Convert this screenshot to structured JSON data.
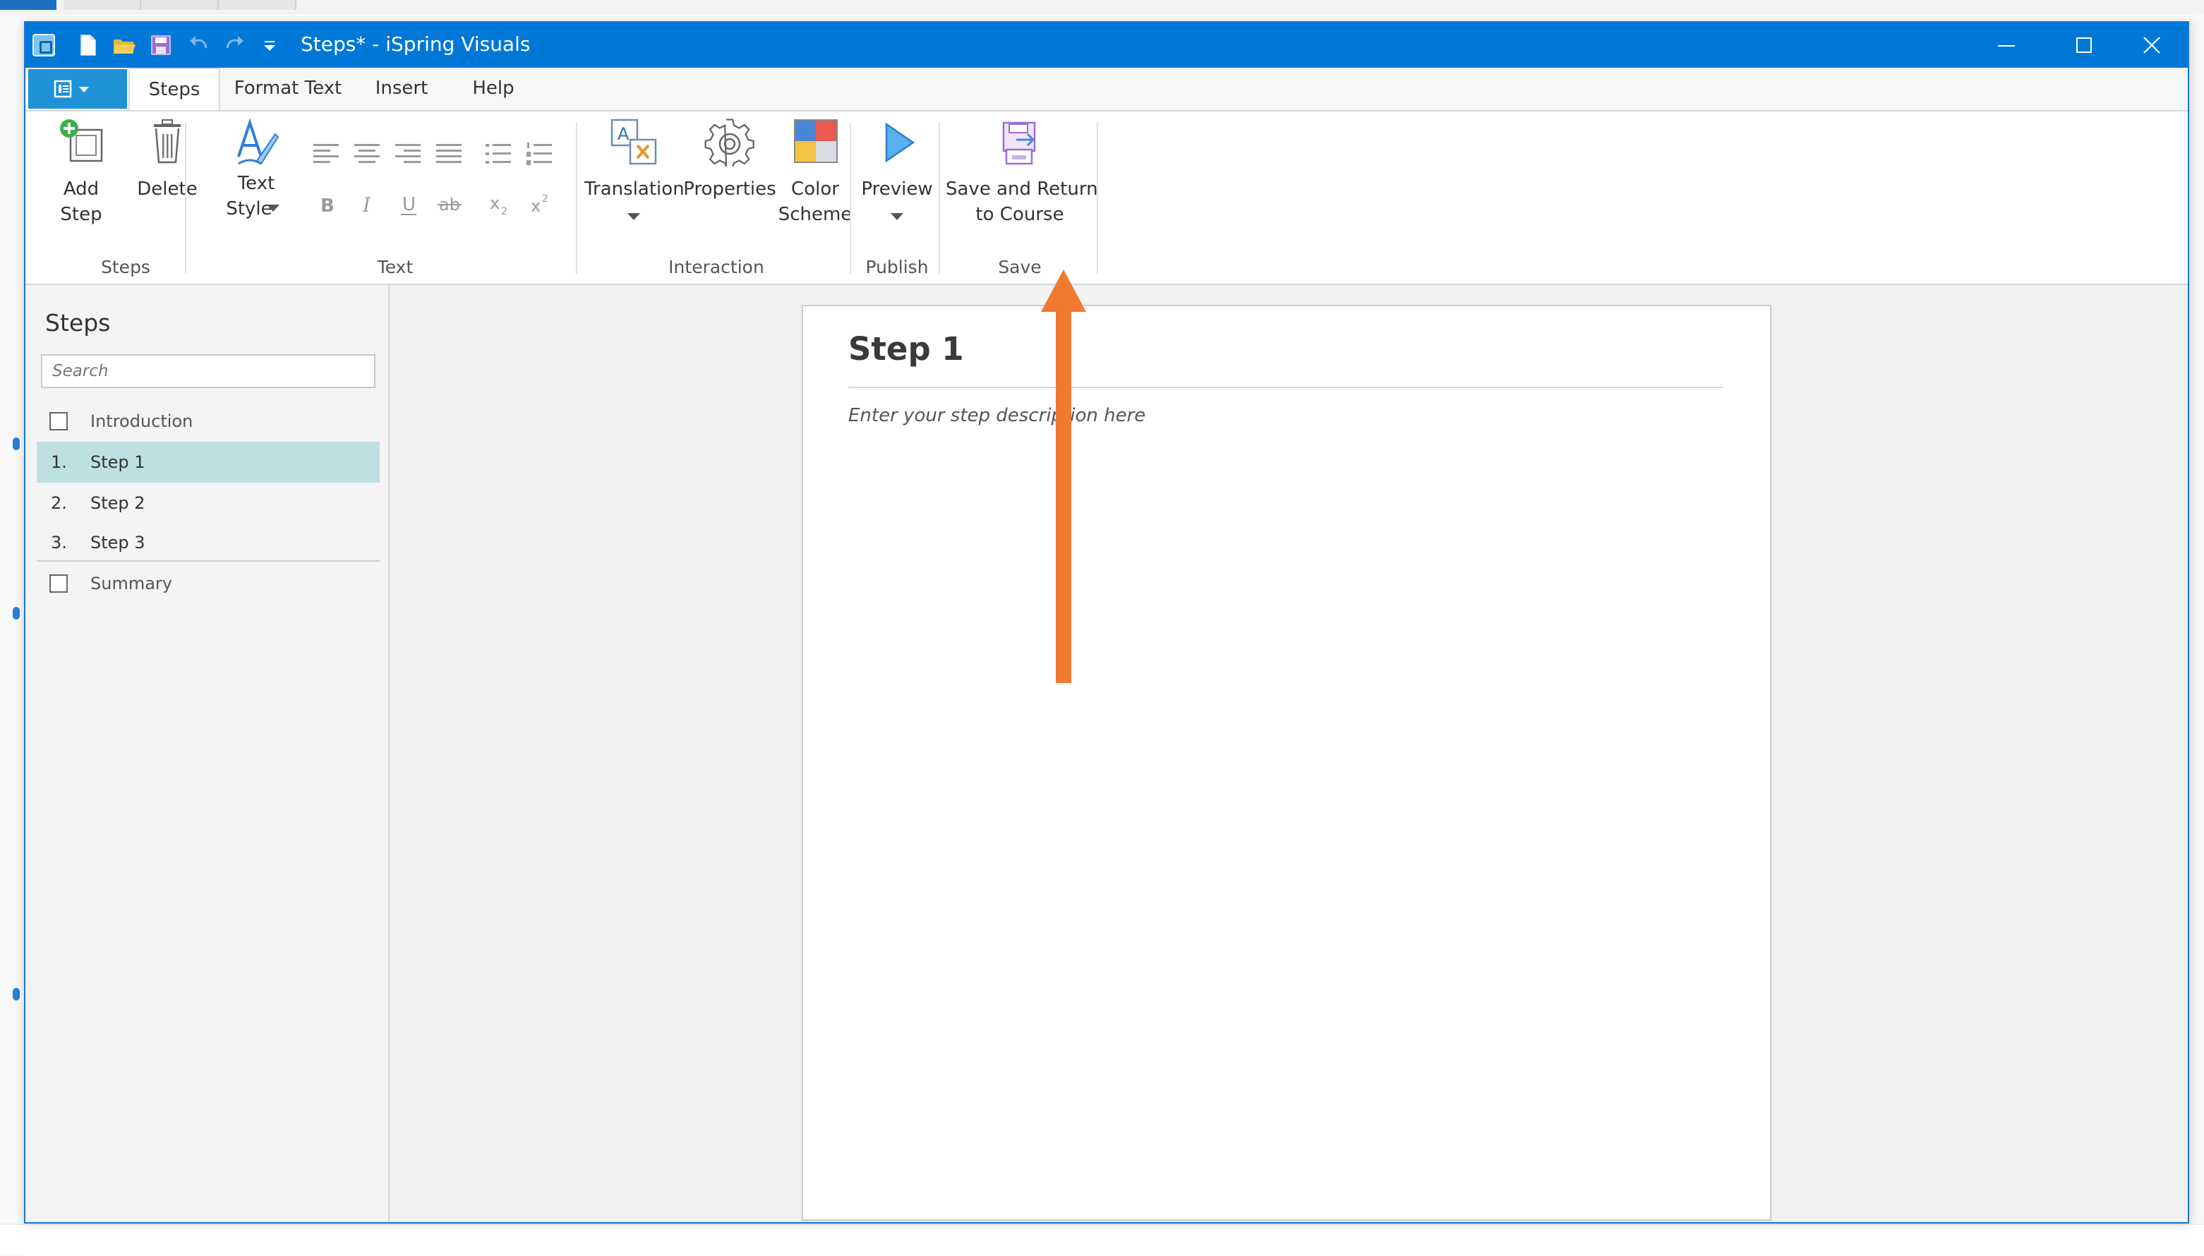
{
  "window": {
    "title": "Steps* - iSpring Visuals"
  },
  "tabs": [
    "Steps",
    "Format Text",
    "Insert",
    "Help"
  ],
  "ribbon": {
    "steps_group": {
      "label": "Steps",
      "add_line1": "Add",
      "add_line2": "Step",
      "delete": "Delete"
    },
    "text_group": {
      "label": "Text",
      "style_line1": "Text",
      "style_line2": "Style"
    },
    "interaction_group": {
      "label": "Interaction",
      "translation": "Translation",
      "properties": "Properties",
      "color_line1": "Color",
      "color_line2": "Scheme"
    },
    "publish_group": {
      "label": "Publish",
      "preview": "Preview"
    },
    "save_group": {
      "label": "Save",
      "save_line1": "Save and Return",
      "save_line2": "to Course"
    }
  },
  "sidebar": {
    "title": "Steps",
    "search_placeholder": "Search",
    "items": [
      {
        "num": "",
        "label": "Introduction",
        "checkbox": true
      },
      {
        "num": "1.",
        "label": "Step 1",
        "selected": true
      },
      {
        "num": "2.",
        "label": "Step 2"
      },
      {
        "num": "3.",
        "label": "Step 3"
      },
      {
        "num": "",
        "label": "Summary",
        "checkbox": true
      }
    ]
  },
  "editor": {
    "heading": "Step 1",
    "description": "Enter your step description here"
  },
  "colors": {
    "accent": "#0078d7",
    "selection": "#bfe0e3",
    "annotation_arrow": "#f07a30"
  },
  "icons": [
    "new-file-icon",
    "open-folder-icon",
    "save-icon",
    "undo-icon",
    "redo-icon",
    "customize-dropdown-icon",
    "minimize-icon",
    "maximize-icon",
    "close-icon",
    "add-step-icon",
    "delete-icon",
    "text-style-icon",
    "translation-icon",
    "properties-gear-icon",
    "color-scheme-icon",
    "preview-play-icon",
    "save-return-icon"
  ]
}
